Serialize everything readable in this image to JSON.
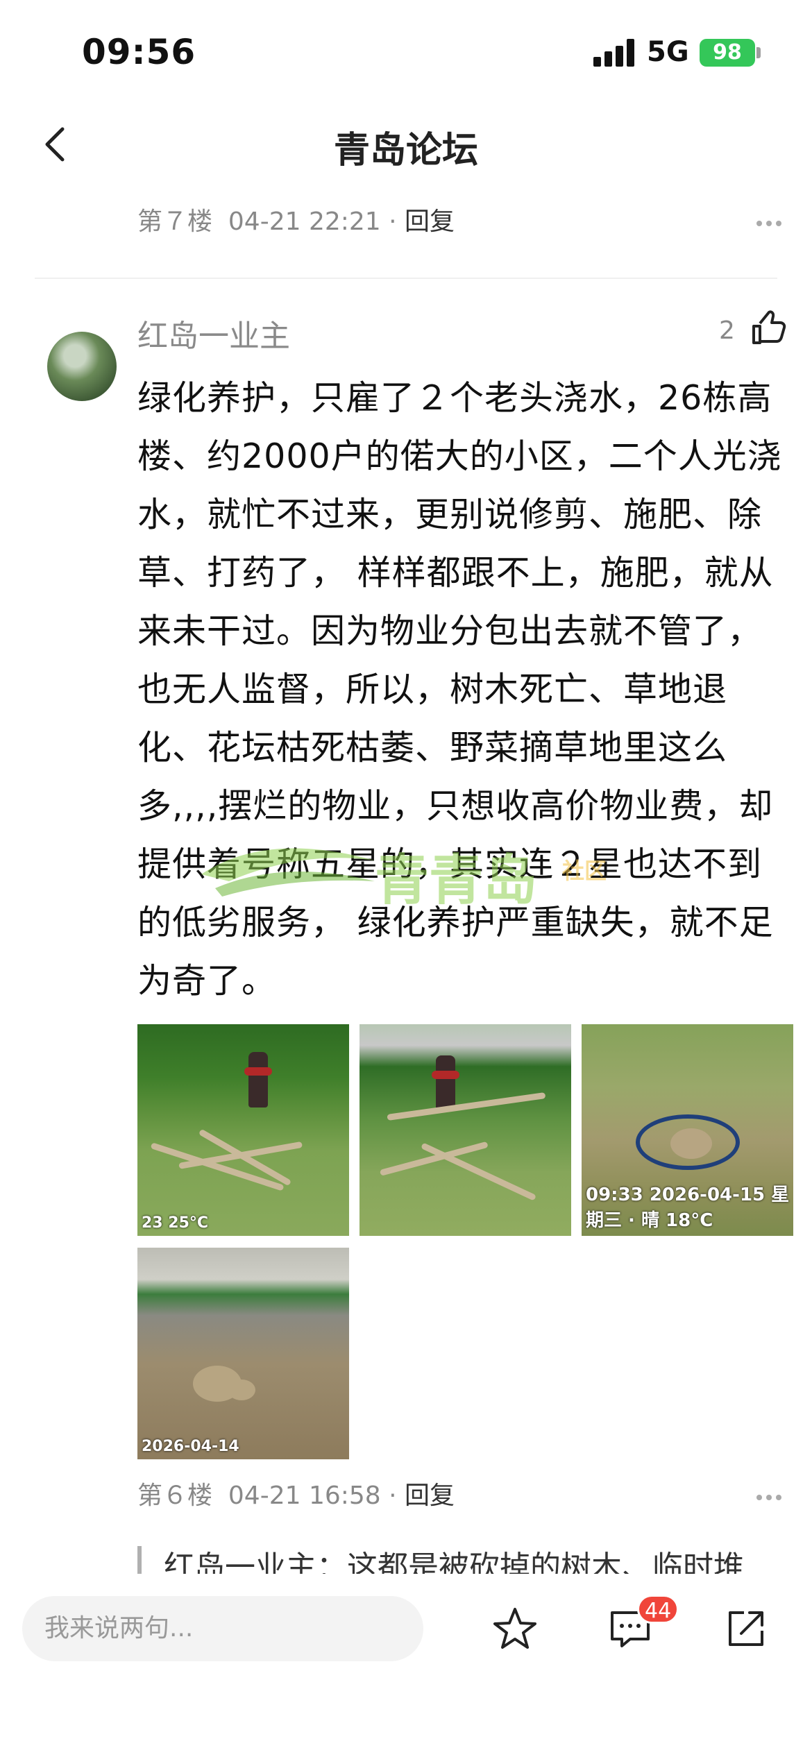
{
  "status": {
    "time": "09:56",
    "network": "5G",
    "battery": "98"
  },
  "nav": {
    "title": "青岛论坛"
  },
  "floor7": {
    "floor": "第７楼",
    "time": "04-21 22:21",
    "separator": " · ",
    "reply": "回复"
  },
  "post": {
    "username": "红岛一业主",
    "likes": "2",
    "body": "绿化养护，只雇了２个老头浇水，26栋高楼、约2000户的偌大的小区，二个人光浇水，就忙不过来，更别说修剪、施肥、除草、打药了， 样样都跟不上，施肥，就从来未干过。因为物业分包出去就不管了，也无人监督，所以，树木死亡、草地退化、花坛枯死枯萎、野菜摘草地里这么多,,,,摆烂的物业，只想收高价物业费，却提供着号称五星的，其实连２星也达不到的低劣服务， 绿化养护严重缺失，就不足为奇了。",
    "watermark": "青青岛",
    "watermark_small": "社区",
    "photos": [
      {
        "stamp": "23 25°C"
      },
      {
        "stamp": ""
      },
      {
        "stamp": "09:33 2026-04-15 星期三 · 晴 18°C"
      },
      {
        "stamp": "2026-04-14"
      }
    ]
  },
  "floor6": {
    "floor": "第６楼",
    "time": "04-21 16:58",
    "separator": " · ",
    "reply": "回复"
  },
  "quote": {
    "text": "红岛一业主：这都是被砍掉的树木、临时堆"
  },
  "bottom": {
    "placeholder": "我来说两句...",
    "comment_badge": "44"
  },
  "colors": {
    "battery": "#34c759",
    "badge": "#f0453a",
    "watermark": "#8fd14f"
  }
}
